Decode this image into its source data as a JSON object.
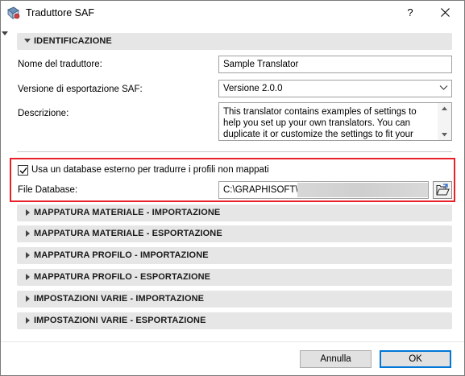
{
  "window": {
    "title": "Traduttore SAF",
    "help_label": "?",
    "icons": {
      "app": "saf-translator-icon",
      "close": "close-icon"
    }
  },
  "identification": {
    "header": "IDENTIFICAZIONE",
    "translator_name_label": "Nome del traduttore:",
    "translator_name_value": "Sample Translator",
    "export_version_label": "Versione di esportazione SAF:",
    "export_version_value": "Versione 2.0.0",
    "description_label": "Descrizione:",
    "description_value": "This translator contains examples of settings to help you set up your own translators. You can duplicate it or customize the settings to fit your"
  },
  "external_db": {
    "checkbox_label": "Usa un database esterno per tradurre i profili non mappati",
    "checked": true,
    "file_label": "File Database:",
    "file_value": "C:\\GRAPHISOFT\\",
    "highlight_color": "#e8202a"
  },
  "sections": [
    "MAPPATURA MATERIALE - IMPORTAZIONE",
    "MAPPATURA MATERIALE - ESPORTAZIONE",
    "MAPPATURA PROFILO - IMPORTAZIONE",
    "MAPPATURA PROFILO - ESPORTAZIONE",
    "IMPOSTAZIONI VARIE - IMPORTAZIONE",
    "IMPOSTAZIONI VARIE - ESPORTAZIONE"
  ],
  "footer": {
    "cancel_label": "Annulla",
    "ok_label": "OK"
  },
  "colors": {
    "accent": "#0078d7",
    "section_bg": "#e6e6e6"
  }
}
